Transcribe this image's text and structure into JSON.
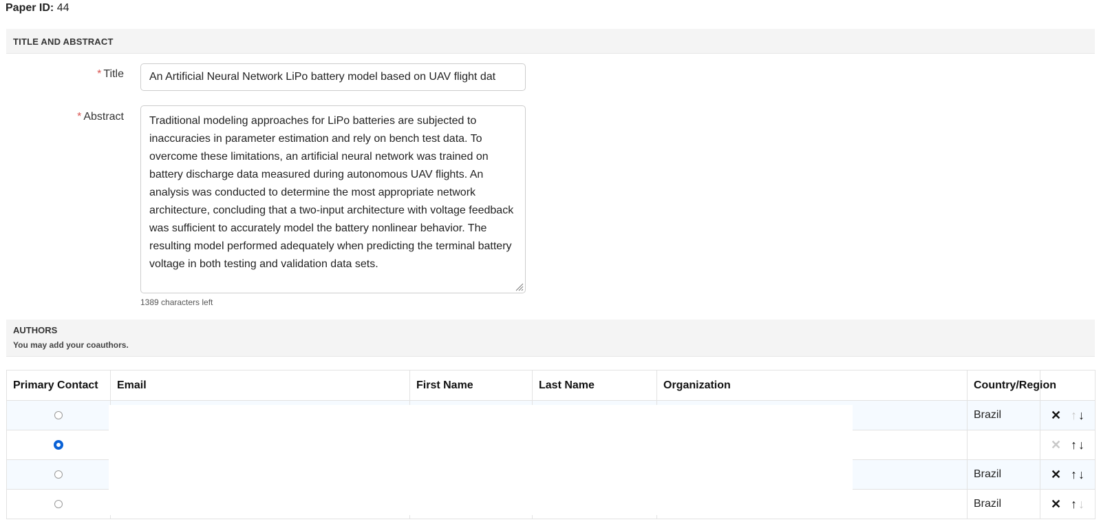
{
  "paper": {
    "id_label": "Paper ID:",
    "id_value": "44"
  },
  "title_section": {
    "header": "TITLE AND ABSTRACT",
    "title_label": "Title",
    "title_value": "An Artificial Neural Network LiPo battery model based on UAV flight dat",
    "abstract_label": "Abstract",
    "abstract_value": "Traditional modeling approaches for LiPo batteries are subjected to inaccuracies in parameter estimation and rely on bench test data. To overcome these limitations, an artificial neural network was trained on battery discharge data measured during autonomous UAV flights. An analysis was conducted to determine the most appropriate network architecture, concluding that a two-input architecture with voltage feedback was sufficient to accurately model the battery nonlinear behavior. The resulting model performed adequately when predicting the terminal battery voltage in both testing and validation data sets.",
    "required_marker": "*",
    "chars_left": "1389 characters left"
  },
  "authors_section": {
    "header": "AUTHORS",
    "subheader": "You may add your coauthors.",
    "columns": [
      "Primary Contact",
      "Email",
      "First Name",
      "Last Name",
      "Organization",
      "Country/Region"
    ],
    "rows": [
      {
        "primary": false,
        "country": "Brazil",
        "delete_enabled": true,
        "up_enabled": false,
        "down_enabled": true
      },
      {
        "primary": true,
        "country": "",
        "delete_enabled": false,
        "up_enabled": true,
        "down_enabled": true
      },
      {
        "primary": false,
        "country": "Brazil",
        "delete_enabled": true,
        "up_enabled": true,
        "down_enabled": true
      },
      {
        "primary": false,
        "country": "Brazil",
        "delete_enabled": true,
        "up_enabled": true,
        "down_enabled": false
      }
    ]
  },
  "icons": {
    "delete": "✕",
    "up": "↑",
    "down": "↓"
  },
  "colors": {
    "radio_checked": "#0b62d6",
    "required": "#d9534f",
    "row_tint": "#f5faff"
  }
}
